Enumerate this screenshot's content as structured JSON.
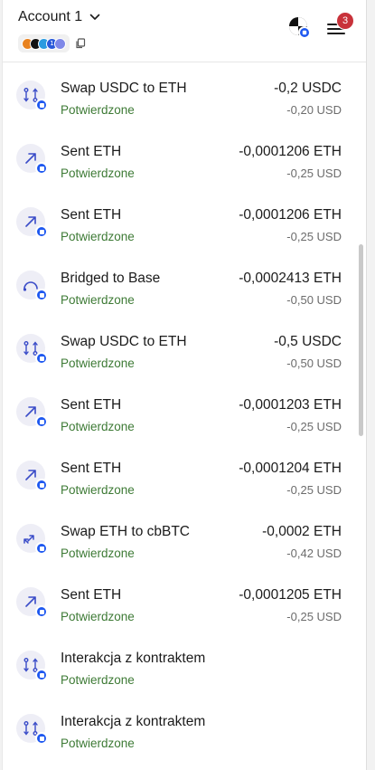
{
  "header": {
    "account_label": "Account 1",
    "network_badge_digit": "1",
    "notification_count": "3"
  },
  "colors": {
    "status_green": "#3d7a35",
    "accent_blue": "#1e58f0",
    "badge_red": "#c8323a",
    "icon_bg": "#eeeef6"
  },
  "transactions": [
    {
      "icon": "swap-contract-icon",
      "title": "Swap USDC to ETH",
      "status": "Potwierdzone",
      "amount": "-0,2 USDC",
      "fiat": "-0,20 USD"
    },
    {
      "icon": "send-arrow-icon",
      "title": "Sent ETH",
      "status": "Potwierdzone",
      "amount": "-0,0001206 ETH",
      "fiat": "-0,25 USD"
    },
    {
      "icon": "send-arrow-icon",
      "title": "Sent ETH",
      "status": "Potwierdzone",
      "amount": "-0,0001206 ETH",
      "fiat": "-0,25 USD"
    },
    {
      "icon": "bridge-icon",
      "title": "Bridged to Base",
      "status": "Potwierdzone",
      "amount": "-0,0002413 ETH",
      "fiat": "-0,50 USD"
    },
    {
      "icon": "swap-contract-icon",
      "title": "Swap USDC to ETH",
      "status": "Potwierdzone",
      "amount": "-0,5 USDC",
      "fiat": "-0,50 USD"
    },
    {
      "icon": "send-arrow-icon",
      "title": "Sent ETH",
      "status": "Potwierdzone",
      "amount": "-0,0001203 ETH",
      "fiat": "-0,25 USD"
    },
    {
      "icon": "send-arrow-icon",
      "title": "Sent ETH",
      "status": "Potwierdzone",
      "amount": "-0,0001204 ETH",
      "fiat": "-0,25 USD"
    },
    {
      "icon": "swap-arrows-icon",
      "title": "Swap ETH to cbBTC",
      "status": "Potwierdzone",
      "amount": "-0,0002 ETH",
      "fiat": "-0,42 USD"
    },
    {
      "icon": "send-arrow-icon",
      "title": "Sent ETH",
      "status": "Potwierdzone",
      "amount": "-0,0001205 ETH",
      "fiat": "-0,25 USD"
    },
    {
      "icon": "swap-contract-icon",
      "title": "Interakcja z kontraktem",
      "status": "Potwierdzone",
      "amount": "",
      "fiat": ""
    },
    {
      "icon": "swap-contract-icon",
      "title": "Interakcja z kontraktem",
      "status": "Potwierdzone",
      "amount": "",
      "fiat": ""
    }
  ]
}
